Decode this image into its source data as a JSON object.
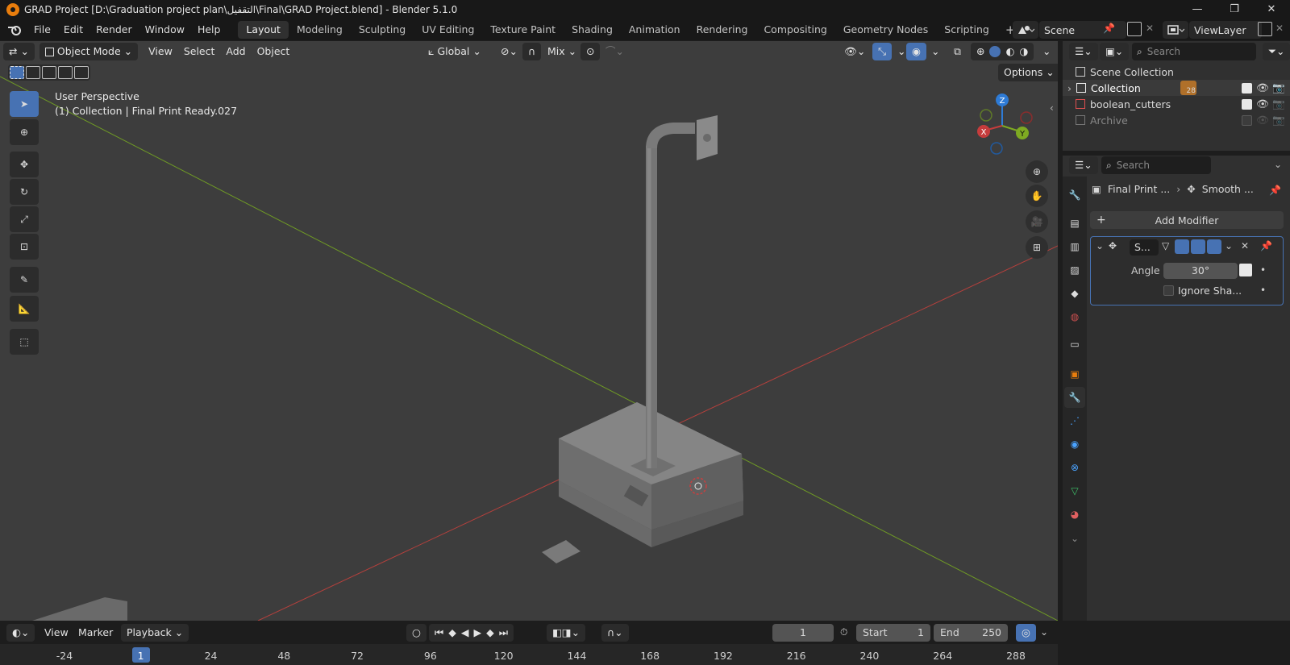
{
  "window": {
    "title": "GRAD Project [D:\\Graduation project plan\\التقفيل\\Final\\GRAD Project.blend] - Blender 5.1.0",
    "minimize": "—",
    "restore": "❐",
    "close": "✕"
  },
  "menu": {
    "items": [
      "File",
      "Edit",
      "Render",
      "Window",
      "Help"
    ]
  },
  "workspaces": {
    "tabs": [
      "Layout",
      "Modeling",
      "Sculpting",
      "UV Editing",
      "Texture Paint",
      "Shading",
      "Animation",
      "Rendering",
      "Compositing",
      "Geometry Nodes",
      "Scripting"
    ],
    "active": "Layout",
    "add": "+"
  },
  "scene": {
    "name": "Scene",
    "view_layer": "ViewLayer"
  },
  "viewport": {
    "mode": "Object Mode",
    "menus": [
      "View",
      "Select",
      "Add",
      "Object"
    ],
    "orientation": "Global",
    "snap": "Mix",
    "options": "Options",
    "perspective": "User Perspective",
    "context": "(1) Collection | Final Print Ready.027",
    "axes": {
      "z": "Z",
      "y": "Y",
      "x": "X"
    }
  },
  "outliner": {
    "search_placeholder": "Search",
    "root": "Scene Collection",
    "items": [
      {
        "name": "Collection",
        "badge": "28"
      },
      {
        "name": "boolean_cutters"
      },
      {
        "name": "Archive"
      }
    ]
  },
  "properties": {
    "search_placeholder": "Search",
    "breadcrumb_object": "Final Print ...",
    "breadcrumb_modifier": "Smooth ...",
    "add_modifier": "Add Modifier",
    "modifier_name": "S...",
    "angle_label": "Angle",
    "angle_value": "30°",
    "ignore_label": "Ignore Sha..."
  },
  "timeline": {
    "menus": [
      "View",
      "Marker",
      "Playback"
    ],
    "current_frame": "1",
    "start_label": "Start",
    "start_value": "1",
    "end_label": "End",
    "end_value": "250",
    "ruler": [
      "-24",
      "1",
      "24",
      "48",
      "72",
      "96",
      "120",
      "144",
      "168",
      "192",
      "216",
      "240",
      "264",
      "288"
    ],
    "ruler_values": [
      -24,
      1,
      24,
      48,
      72,
      96,
      120,
      144,
      168,
      192,
      216,
      240,
      264,
      288
    ],
    "current": 1
  },
  "colors": {
    "accent": "#4772b3",
    "x_axis": "#c63c3c",
    "y_axis": "#7eaa22",
    "z_axis": "#2e7bd6",
    "scene_icon": "#e87d0d"
  }
}
